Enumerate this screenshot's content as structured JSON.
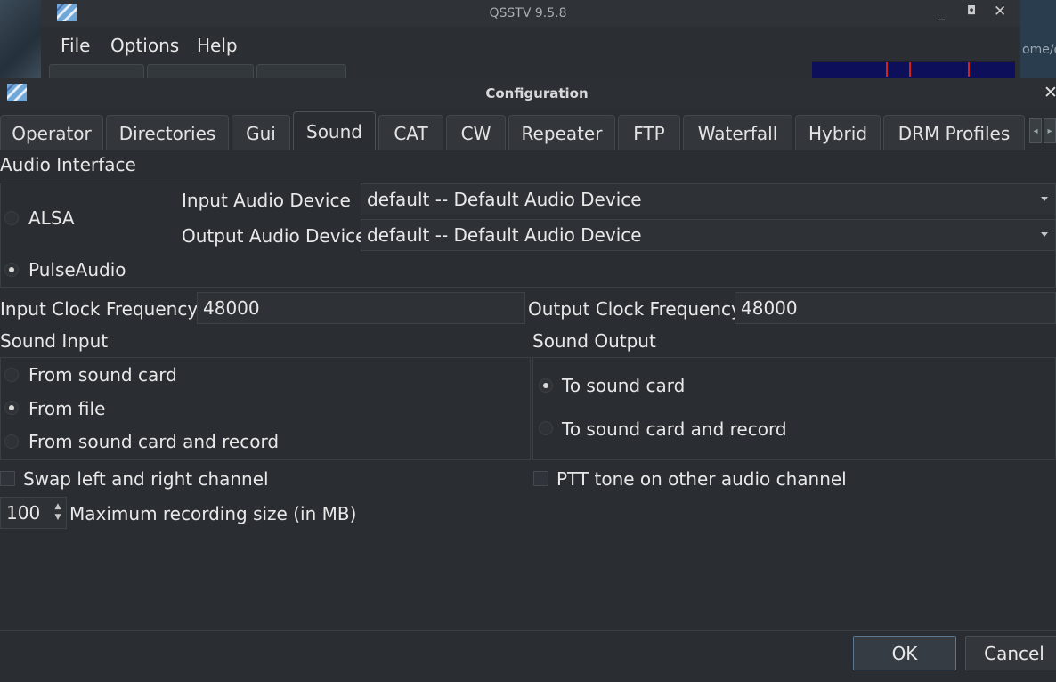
{
  "background_window": {
    "title": "QSSTV 9.5.8",
    "menu": [
      "File",
      "Options",
      "Help"
    ],
    "path_fragment": "ome/c",
    "minimize_glyph": "_",
    "maximize_glyph": "◘",
    "close_glyph": "✕"
  },
  "dialog": {
    "title": "Configuration",
    "close_glyph": "✕",
    "tabs": [
      "Operator",
      "Directories",
      "Gui",
      "Sound",
      "CAT",
      "CW",
      "Repeater",
      "FTP",
      "Waterfall",
      "Hybrid",
      "DRM Profiles"
    ],
    "active_tab": "Sound"
  },
  "audio_interface": {
    "label": "Audio Interface",
    "alsa": "ALSA",
    "pulse": "PulseAudio",
    "selected": "PulseAudio",
    "input_device_label": "Input Audio Device",
    "input_device_value": "default -- Default Audio Device",
    "output_device_label": "Output Audio Device",
    "output_device_value": "default -- Default Audio Device"
  },
  "clocks": {
    "input_label": "Input  Clock Frequency",
    "input_value": "48000",
    "output_label": "Output Clock Frequency",
    "output_value": "48000"
  },
  "sound_input": {
    "label": "Sound Input",
    "options": [
      "From sound card",
      "From file",
      "From sound card and record"
    ],
    "selected": "From file"
  },
  "sound_output": {
    "label": "Sound Output",
    "options": [
      "To sound card",
      "To sound card and record"
    ],
    "selected": "To sound card"
  },
  "checkboxes": {
    "swap": "Swap left and right channel",
    "ptt": "PTT tone on other audio channel"
  },
  "recording": {
    "value": "100",
    "label": "Maximum recording size (in MB)"
  },
  "buttons": {
    "ok": "OK",
    "cancel": "Cancel"
  },
  "colors": {
    "background": "#2a2e32",
    "waterfall": "#0d0f5a",
    "ok_border": "#5a7891"
  }
}
